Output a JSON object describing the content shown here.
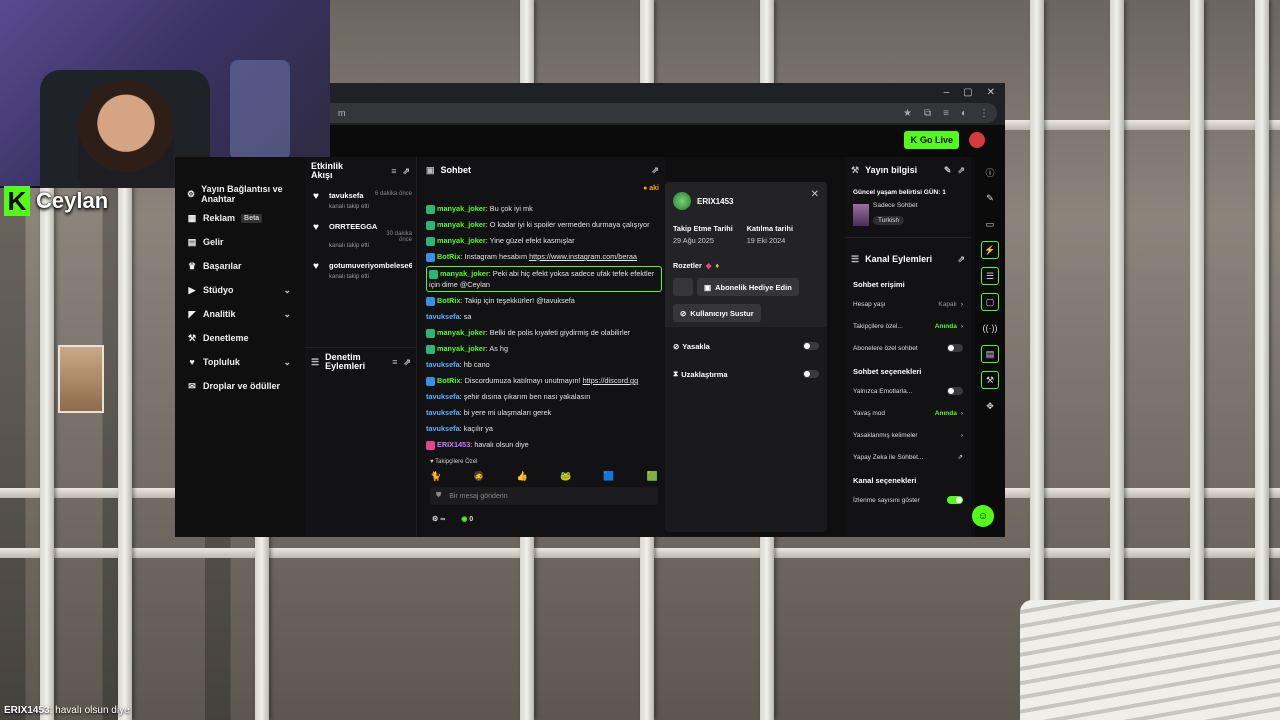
{
  "stream": {
    "streamer_name": "Ceylan",
    "overlay_chat_user": "ERIX1453",
    "overlay_chat_text": ": havalı olsun diye"
  },
  "browser": {
    "url_fragment": "m",
    "win_min": "–",
    "win_max": "▢",
    "win_close": "✕"
  },
  "appbar": {
    "go_live": "Go Live"
  },
  "nav": {
    "items": [
      {
        "label": "Yayın Bağlantısı ve Anahtar",
        "icon": "⚙"
      },
      {
        "label": "Reklam",
        "icon": "▦",
        "badge": "Beta"
      },
      {
        "label": "Gelir",
        "icon": "▤"
      },
      {
        "label": "Başarılar",
        "icon": "♛"
      },
      {
        "label": "Stüdyo",
        "icon": "▶",
        "chevron": "⌄"
      },
      {
        "label": "Analitik",
        "icon": "◤",
        "chevron": "⌄"
      },
      {
        "label": "Denetleme",
        "icon": "⚒"
      },
      {
        "label": "Topluluk",
        "icon": "♥",
        "chevron": "⌄"
      },
      {
        "label": "Droplar ve ödüller",
        "icon": "✉"
      }
    ]
  },
  "activity": {
    "title": "Etkinlik Akışı",
    "events": [
      {
        "user": "tavuksefa",
        "time": "6 dakika önce",
        "desc": "kanalı takip etti"
      },
      {
        "user": "ORRTEEGGA",
        "time": "30 dakika önce",
        "desc": "kanalı takip etti"
      },
      {
        "user": "gotumuveriyombelese67",
        "time": "",
        "desc": "kanalı takip etti"
      }
    ],
    "mod_title": "Denetim Eylemleri"
  },
  "chat": {
    "title": "Sohbet",
    "pinned": "aki",
    "messages": [
      {
        "user": "manyak_joker",
        "text": ": Bu çok iyi mk",
        "color": "#53fc18",
        "badge": "#2bb673"
      },
      {
        "user": "manyak_joker",
        "text": ": O kadar iyi ki spoiler vermeden durmaya çalışıyor",
        "color": "#53fc18",
        "badge": "#2bb673"
      },
      {
        "user": "manyak_joker",
        "text": ": Yine güzel efekt kasmışlar",
        "color": "#53fc18",
        "badge": "#2bb673"
      },
      {
        "user": "BotRix",
        "text": ": Instagram hesabım ",
        "link": "https://www.instagram.com/beraa",
        "color": "#53fc18",
        "badge": "#3a8ee6"
      },
      {
        "user": "manyak_joker",
        "text": ": Peki abi hiç efekt yoksa sadece ufak tefek efektler için dime @Ceylan",
        "color": "#53fc18",
        "badge": "#2bb673",
        "highlight": true
      },
      {
        "user": "BotRix",
        "text": ": Takip için teşekkürler! @tavuksefa",
        "color": "#53fc18",
        "badge": "#3a8ee6"
      },
      {
        "user": "tavuksefa",
        "text": ": sa",
        "color": "#5ab0ff",
        "badge": ""
      },
      {
        "user": "manyak_joker",
        "text": ": Belki de polis kıyafeti giydirmiş de olabilirler",
        "color": "#53fc18",
        "badge": "#2bb673"
      },
      {
        "user": "manyak_joker",
        "text": ": As hg",
        "color": "#53fc18",
        "badge": "#2bb673"
      },
      {
        "user": "tavuksefa",
        "text": ": hb cano",
        "color": "#5ab0ff",
        "badge": ""
      },
      {
        "user": "BotRix",
        "text": ": Discordumuza katılmayı unutmayın! ",
        "link": "https://discord.gg",
        "color": "#53fc18",
        "badge": "#3a8ee6"
      },
      {
        "user": "tavuksefa",
        "text": ": şehir dısına çıkarım ben nası yakalasın",
        "color": "#5ab0ff",
        "badge": ""
      },
      {
        "user": "tavuksefa",
        "text": ": bi yere mi ulaşmaları gerek",
        "color": "#5ab0ff",
        "badge": ""
      },
      {
        "user": "tavuksefa",
        "text": ": kaçılır ya",
        "color": "#5ab0ff",
        "badge": ""
      },
      {
        "user": "ERIX1453",
        "text": ": havalı olsun diye",
        "color": "#c77dff",
        "badge": "#e84393"
      }
    ],
    "followers_only": "Takipçilere Özel",
    "input_placeholder": "Bir mesaj gönderin",
    "viewer_glyph": "∞",
    "points": "0"
  },
  "usercard": {
    "username": "ERIX1453",
    "follow_label": "Takip Etme Tarihi",
    "follow_date": "29 Ağu 2025",
    "join_label": "Katılma tarihi",
    "join_date": "19 Eki 2024",
    "badges_label": "Rozetler",
    "gift_sub": "Abonelik Hediye Edin",
    "mute": "Kullanıcıyı Sustur",
    "ban": "Yasakla",
    "timeout": "Uzaklaştırma"
  },
  "stream_info": {
    "title": "Yayın bilgisi",
    "current_title": "Güncel yaşam belirtisi GÜN: 1",
    "category": "Sadece Sohbet",
    "language": "Turkish"
  },
  "channel_actions": {
    "title": "Kanal Eylemleri",
    "chat_access": "Sohbet erişimi",
    "rows_access": [
      {
        "label": "Hesap yaşı",
        "value": "Kapalı",
        "value_color": "grey",
        "control": "chevron"
      },
      {
        "label": "Takipçilere özel...",
        "value": "Anında",
        "value_color": "green",
        "control": "chevron"
      },
      {
        "label": "Abonelere özel sohbet",
        "value": "",
        "control": "toggle-off"
      }
    ],
    "chat_options": "Sohbet seçenekleri",
    "rows_options": [
      {
        "label": "Yalnızca Emotlarla...",
        "value": "",
        "control": "toggle-off"
      },
      {
        "label": "Yavaş mod",
        "value": "Anında",
        "value_color": "green",
        "control": "chevron"
      },
      {
        "label": "Yasaklanmış kelimeler",
        "value": "",
        "control": "chevron"
      },
      {
        "label": "Yapay Zeka ile Sohbet...",
        "value": "",
        "control": "external"
      }
    ],
    "channel_options": "Kanal seçenekleri",
    "rows_channel": [
      {
        "label": "İzlenme sayısını göster",
        "value": "",
        "control": "toggle-on"
      }
    ]
  },
  "colors": {
    "accent": "#53fc18",
    "panel": "#121214",
    "bg": "#0f0f10"
  }
}
